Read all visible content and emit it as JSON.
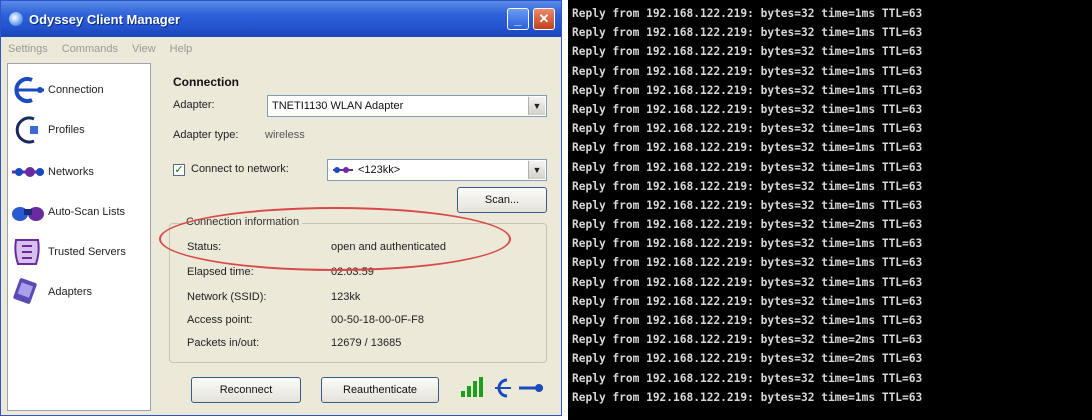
{
  "window": {
    "title": "Odyssey Client Manager",
    "minimize_glyph": "_",
    "close_glyph": "✕"
  },
  "menu": [
    "Settings",
    "Commands",
    "View",
    "Help"
  ],
  "sidebar": {
    "items": [
      {
        "label": "Connection",
        "icon": "connection-icon"
      },
      {
        "label": "Profiles",
        "icon": "profiles-icon"
      },
      {
        "label": "Networks",
        "icon": "networks-icon"
      },
      {
        "label": "Auto-Scan Lists",
        "icon": "auto-scan-icon"
      },
      {
        "label": "Trusted Servers",
        "icon": "trusted-servers-icon"
      },
      {
        "label": "Adapters",
        "icon": "adapters-icon"
      }
    ]
  },
  "connection": {
    "title": "Connection",
    "adapter_label": "Adapter:",
    "adapter_value": "TNETI1130 WLAN Adapter",
    "adapter_type_label": "Adapter type:",
    "adapter_type_value": "wireless",
    "connect_label": "Connect to network:",
    "connect_checked": "✓",
    "network_value": "<123kk>",
    "scan_button": "Scan...",
    "info_title": "Connection information",
    "info": [
      {
        "label": "Status:",
        "value": "open and authenticated"
      },
      {
        "label": "Elapsed time:",
        "value": "02:03:59"
      },
      {
        "label": "Network (SSID):",
        "value": "123kk"
      },
      {
        "label": "Access point:",
        "value": "00-50-18-00-0F-F8"
      },
      {
        "label": "Packets in/out:",
        "value": "12679 / 13685"
      }
    ],
    "reconnect_button": "Reconnect",
    "reauthenticate_button": "Reauthenticate"
  },
  "console": {
    "lines": [
      "Reply from 192.168.122.219: bytes=32 time=1ms TTL=63",
      "Reply from 192.168.122.219: bytes=32 time=1ms TTL=63",
      "Reply from 192.168.122.219: bytes=32 time=1ms TTL=63",
      "Reply from 192.168.122.219: bytes=32 time=1ms TTL=63",
      "Reply from 192.168.122.219: bytes=32 time=1ms TTL=63",
      "Reply from 192.168.122.219: bytes=32 time=1ms TTL=63",
      "Reply from 192.168.122.219: bytes=32 time=1ms TTL=63",
      "Reply from 192.168.122.219: bytes=32 time=1ms TTL=63",
      "Reply from 192.168.122.219: bytes=32 time=1ms TTL=63",
      "Reply from 192.168.122.219: bytes=32 time=1ms TTL=63",
      "Reply from 192.168.122.219: bytes=32 time=1ms TTL=63",
      "Reply from 192.168.122.219: bytes=32 time=2ms TTL=63",
      "Reply from 192.168.122.219: bytes=32 time=1ms TTL=63",
      "Reply from 192.168.122.219: bytes=32 time=1ms TTL=63",
      "Reply from 192.168.122.219: bytes=32 time=1ms TTL=63",
      "Reply from 192.168.122.219: bytes=32 time=1ms TTL=63",
      "Reply from 192.168.122.219: bytes=32 time=1ms TTL=63",
      "Reply from 192.168.122.219: bytes=32 time=2ms TTL=63",
      "Reply from 192.168.122.219: bytes=32 time=2ms TTL=63",
      "Reply from 192.168.122.219: bytes=32 time=1ms TTL=63",
      "Reply from 192.168.122.219: bytes=32 time=1ms TTL=63"
    ]
  },
  "colors": {
    "titlebar": "#2455d0",
    "annotation": "#d84a4a",
    "console_bg": "#000000",
    "console_text": "#d8d8d8"
  }
}
